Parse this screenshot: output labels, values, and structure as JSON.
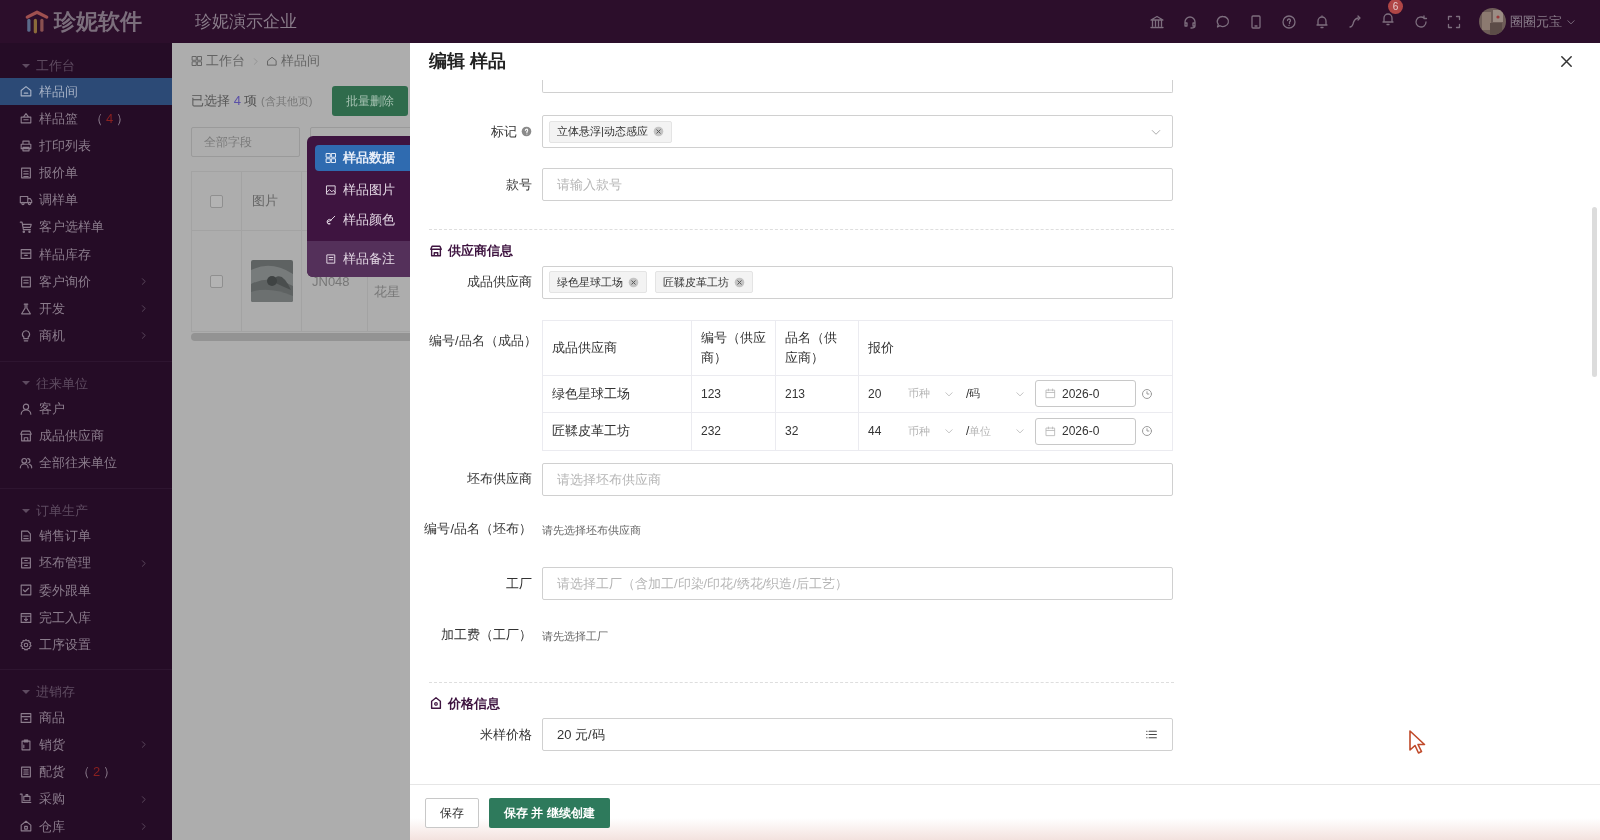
{
  "topbar": {
    "brand": "珍妮软件",
    "company": "珍妮演示企业",
    "notification_count": "6",
    "user_name": "圈圈元宝"
  },
  "sidebar": {
    "sections": [
      {
        "title": "工作台",
        "expanded": true,
        "items": [
          {
            "label": "样品间",
            "selected": true,
            "has_children": false
          },
          {
            "label": "样品篮",
            "count": "4",
            "count_brackets": [
              "（",
              "）"
            ],
            "selected": false,
            "has_children": false
          },
          {
            "label": "打印列表",
            "selected": false,
            "has_children": false
          },
          {
            "label": "报价单",
            "selected": false,
            "has_children": false
          },
          {
            "label": "调样单",
            "selected": false,
            "has_children": false
          },
          {
            "label": "客户选样单",
            "selected": false,
            "has_children": false
          },
          {
            "label": "样品库存",
            "selected": false,
            "has_children": false
          },
          {
            "label": "客户询价",
            "selected": false,
            "has_children": true
          },
          {
            "label": "开发",
            "selected": false,
            "has_children": true
          },
          {
            "label": "商机",
            "selected": false,
            "has_children": true
          }
        ]
      },
      {
        "title": "往来单位",
        "expanded": true,
        "items": [
          {
            "label": "客户",
            "selected": false,
            "has_children": false
          },
          {
            "label": "成品供应商",
            "selected": false,
            "has_children": false
          },
          {
            "label": "全部往来单位",
            "selected": false,
            "has_children": false
          }
        ]
      },
      {
        "title": "订单生产",
        "expanded": true,
        "items": [
          {
            "label": "销售订单",
            "selected": false,
            "has_children": false
          },
          {
            "label": "坯布管理",
            "selected": false,
            "has_children": true
          },
          {
            "label": "委外跟单",
            "selected": false,
            "has_children": false
          },
          {
            "label": "完工入库",
            "selected": false,
            "has_children": false
          },
          {
            "label": "工序设置",
            "selected": false,
            "has_children": false
          }
        ]
      },
      {
        "title": "进销存",
        "expanded": true,
        "items": [
          {
            "label": "商品",
            "selected": false,
            "has_children": false
          },
          {
            "label": "销货",
            "selected": false,
            "has_children": true
          },
          {
            "label": "配货",
            "count": "2",
            "count_brackets": [
              "（",
              "）"
            ],
            "selected": false,
            "has_children": false
          },
          {
            "label": "采购",
            "selected": false,
            "has_children": true
          },
          {
            "label": "仓库",
            "selected": false,
            "has_children": true
          }
        ]
      }
    ]
  },
  "background_page": {
    "breadcrumb": [
      "工作台",
      "样品间"
    ],
    "selection": {
      "prefix": "已选择",
      "count": "4",
      "suffix": "项",
      "note": "(含其他页)"
    },
    "bulk_delete": "批量删除",
    "field_select": "全部字段",
    "table": {
      "all_selected": false,
      "columns": [
        "图片"
      ],
      "rows": [
        {
          "selected": false,
          "code": "JN048",
          "name": "花星"
        }
      ]
    }
  },
  "popup_menu": [
    {
      "label": "样品数据",
      "selected": true,
      "hovered": false
    },
    {
      "label": "样品图片",
      "selected": false,
      "hovered": false
    },
    {
      "label": "样品颜色",
      "selected": false,
      "hovered": false
    },
    {
      "label": "样品备注",
      "selected": false,
      "hovered": true
    }
  ],
  "drawer": {
    "title": "编辑 样品",
    "tags_field": {
      "label": "标记",
      "tags": [
        "立体悬浮|动态感应"
      ]
    },
    "style_no": {
      "label": "款号",
      "placeholder": "请输入款号"
    },
    "supplier_section": "供应商信息",
    "suppliers": {
      "label": "成品供应商",
      "tags": [
        "绿色星球工场",
        "匠鞣皮革工坊"
      ]
    },
    "supplier_table": {
      "label": "编号/品名（成品）",
      "columns": [
        "成品供应商",
        "编号（供应商）",
        "品名（供应商）",
        "报价"
      ],
      "rows": [
        {
          "supplier": "绿色星球工场",
          "code": "123",
          "name": "213",
          "price": "20",
          "currency_placeholder": "币种",
          "unit_prefix": "/",
          "unit": "码",
          "unit_is_placeholder": false,
          "date": "2026-0"
        },
        {
          "supplier": "匠鞣皮革工坊",
          "code": "232",
          "name": "32",
          "price": "44",
          "currency_placeholder": "币种",
          "unit_prefix": "/",
          "unit": "单位",
          "unit_is_placeholder": true,
          "date": "2026-0"
        }
      ]
    },
    "grey_supplier": {
      "label": "坯布供应商",
      "placeholder": "请选择坯布供应商"
    },
    "grey_code": {
      "label": "编号/品名（坯布）",
      "hint": "请先选择坯布供应商"
    },
    "factory": {
      "label": "工厂",
      "placeholder": "请选择工厂（含加工/印染/印花/绣花/织造/后工艺）"
    },
    "factory_fee": {
      "label": "加工费（工厂）",
      "hint": "请先选择工厂"
    },
    "price_section": "价格信息",
    "sample_price": {
      "label": "米样价格",
      "value": "20 元/码"
    },
    "buttons": [
      {
        "label": "保存",
        "kind": "plain"
      },
      {
        "label": "保存 并 继续创建",
        "kind": "primary"
      }
    ]
  }
}
